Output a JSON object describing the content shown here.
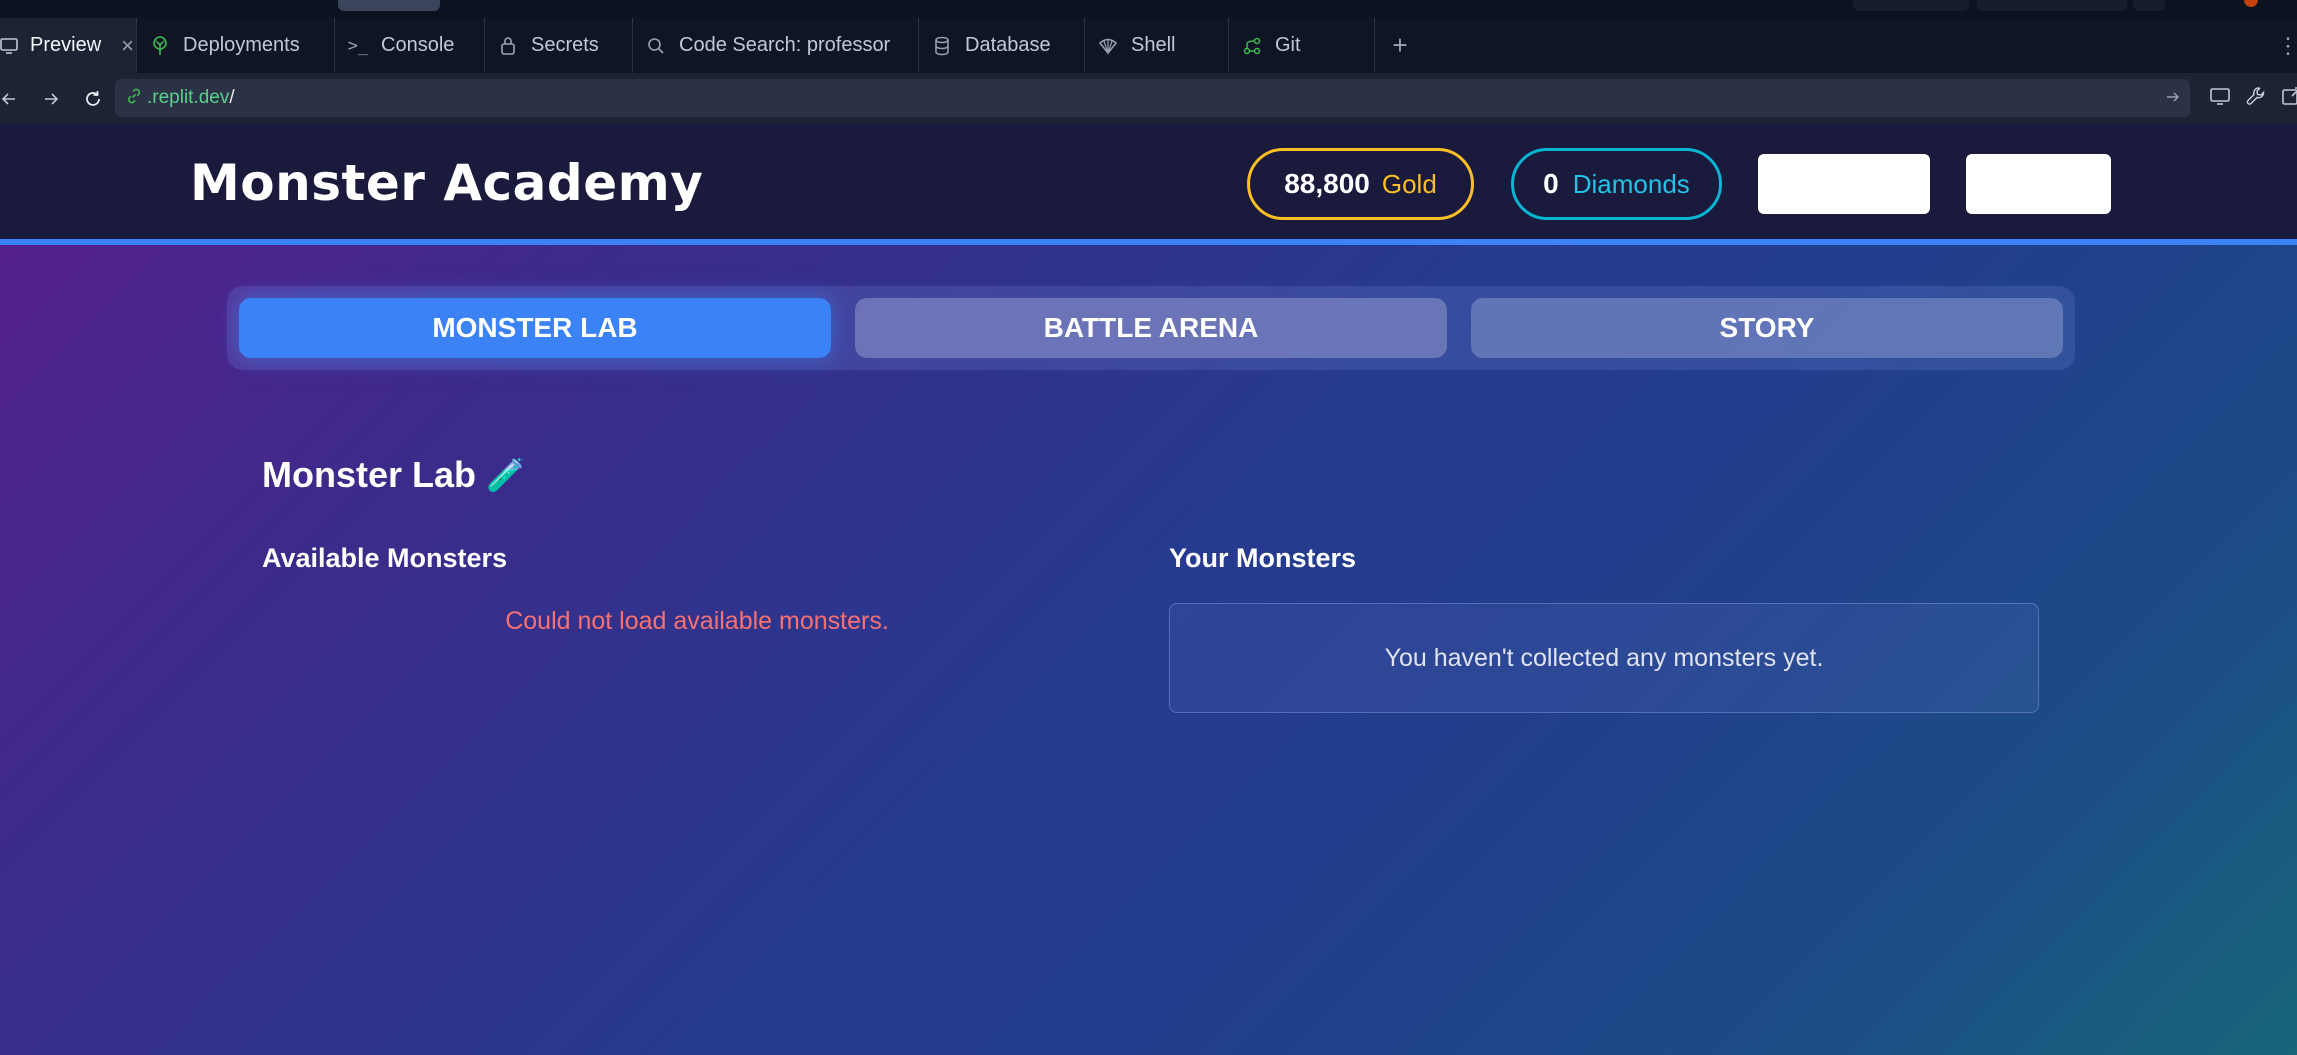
{
  "browser": {
    "tabs": [
      {
        "label": "Preview",
        "icon": "monitor-icon"
      },
      {
        "label": "Deployments",
        "icon": "deploy-icon"
      },
      {
        "label": "Console",
        "icon": "terminal-icon"
      },
      {
        "label": "Secrets",
        "icon": "lock-icon"
      },
      {
        "label": "Code Search: professor",
        "icon": "search-icon"
      },
      {
        "label": "Database",
        "icon": "database-icon"
      },
      {
        "label": "Shell",
        "icon": "shell-icon"
      },
      {
        "label": "Git",
        "icon": "git-icon"
      }
    ],
    "add_tab": "+",
    "url_host": ".replit.dev",
    "url_path": "/"
  },
  "app": {
    "brand": "Monster Academy",
    "gold": {
      "value": "88,800",
      "unit": "Gold"
    },
    "diamonds": {
      "value": "0",
      "unit": "Diamonds"
    },
    "nav": {
      "tabs": [
        "MONSTER LAB",
        "BATTLE ARENA",
        "STORY"
      ],
      "active": "MONSTER LAB"
    },
    "section_title": "Monster Lab",
    "section_emoji": "🧪",
    "available": {
      "title": "Available Monsters",
      "error": "Could not load available monsters."
    },
    "yours": {
      "title": "Your Monsters",
      "empty": "You haven't collected any monsters yet."
    }
  },
  "colors": {
    "accent": "#3b82f6",
    "gold": "#fbbf24",
    "diamond": "#06b6d4",
    "error": "#f87171"
  }
}
